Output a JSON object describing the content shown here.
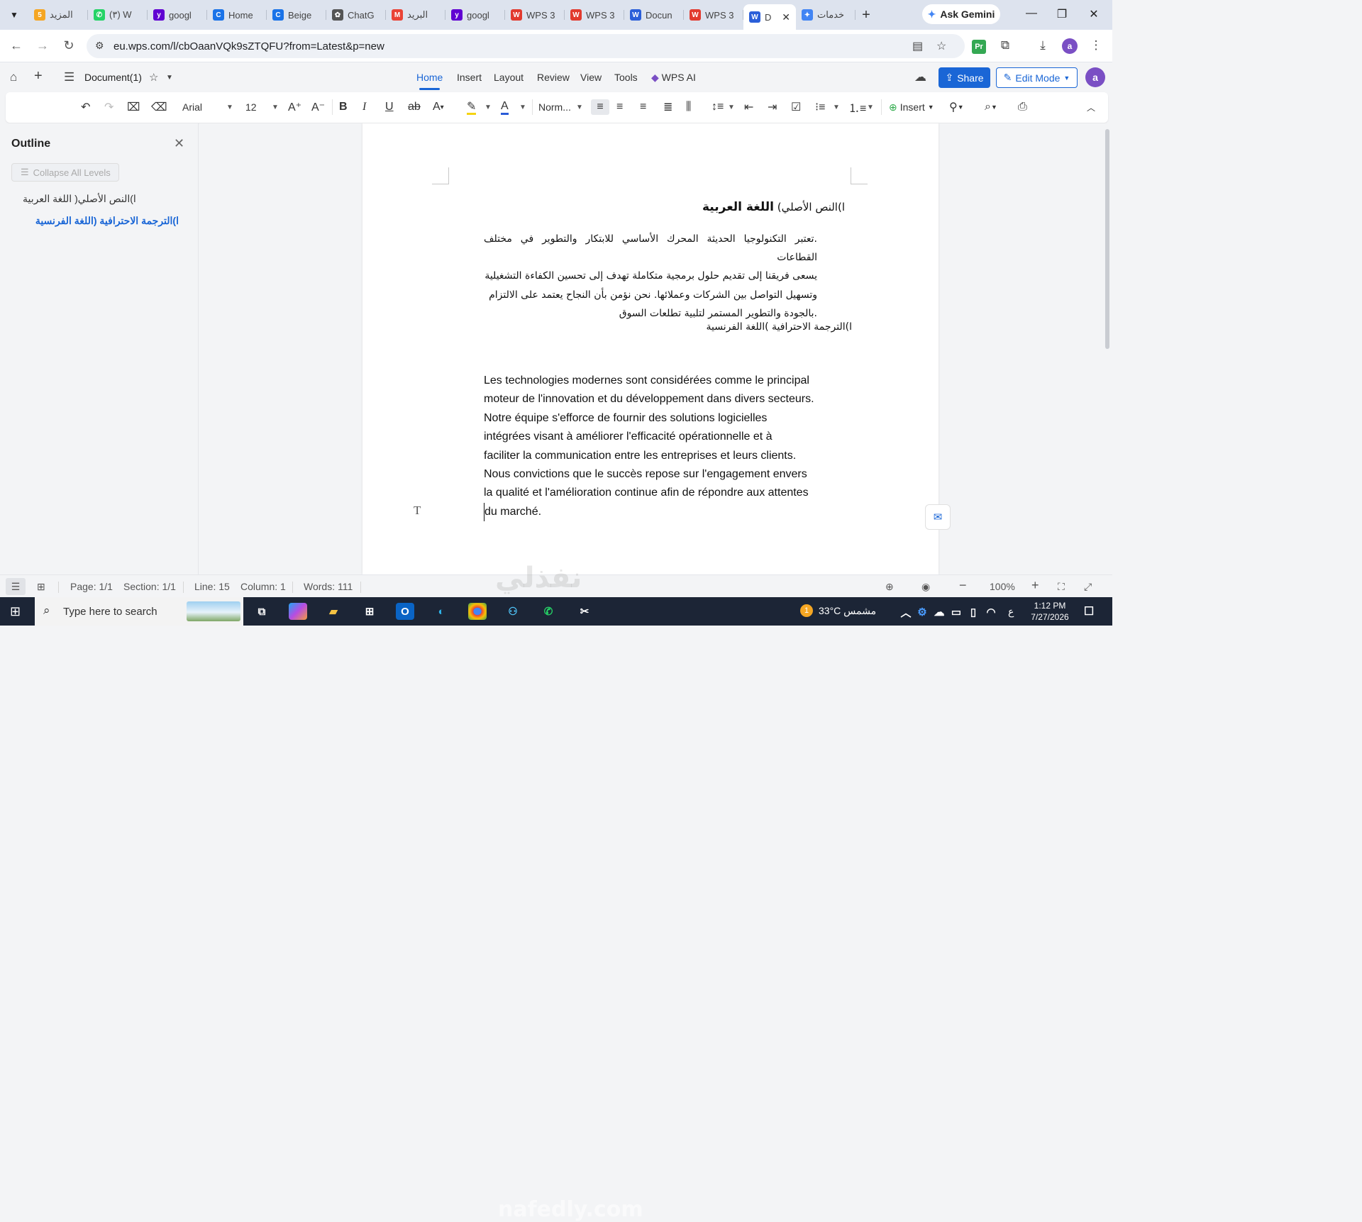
{
  "browser": {
    "tabs": [
      {
        "label": "المزيد",
        "icon": "orange-5-icon",
        "color": "#f5a623",
        "glyph": "5"
      },
      {
        "label": "(٣) W",
        "icon": "whatsapp-icon",
        "color": "#25d366",
        "glyph": "✆"
      },
      {
        "label": "googl",
        "icon": "yahoo-icon",
        "color": "#6001d2",
        "glyph": "y"
      },
      {
        "label": "Home",
        "icon": "copilot-icon",
        "color": "#1a73e8",
        "glyph": "C"
      },
      {
        "label": "Beige",
        "icon": "copilot-icon",
        "color": "#1a73e8",
        "glyph": "C"
      },
      {
        "label": "ChatG",
        "icon": "chatgpt-icon",
        "color": "#555555",
        "glyph": "✿"
      },
      {
        "label": "البريد",
        "icon": "gmail-icon",
        "color": "#ea4335",
        "glyph": "M"
      },
      {
        "label": "googl",
        "icon": "yahoo-icon",
        "color": "#6001d2",
        "glyph": "y"
      },
      {
        "label": "WPS 3",
        "icon": "wps-icon",
        "color": "#e23a2e",
        "glyph": "W"
      },
      {
        "label": "WPS 3",
        "icon": "wps-icon",
        "color": "#e23a2e",
        "glyph": "W"
      },
      {
        "label": "Docun",
        "icon": "word-icon",
        "color": "#2b5fd9",
        "glyph": "W"
      },
      {
        "label": "WPS 3",
        "icon": "wps-icon",
        "color": "#e23a2e",
        "glyph": "W"
      },
      {
        "label": "D",
        "icon": "word-icon",
        "color": "#2b5fd9",
        "glyph": "W",
        "active": true
      },
      {
        "label": "خدمات",
        "icon": "gemini-icon",
        "color": "#4285f4",
        "glyph": "✦"
      }
    ],
    "ask_gemini": "Ask Gemini",
    "url": "eu.wps.com/l/cbOaanVQk9sZTQFU?from=Latest&p=new",
    "profile_initial": "a",
    "pr_badge": "Pr"
  },
  "wps": {
    "doc_title": "Document(1)",
    "menu": [
      "Home",
      "Insert",
      "Layout",
      "Review",
      "View",
      "Tools",
      "WPS AI"
    ],
    "share": "Share",
    "edit_mode": "Edit Mode",
    "user_initial": "a",
    "font_name": "Arial",
    "font_size": "12",
    "style": "Norm...",
    "insert": "Insert",
    "accent": "#1a66d6"
  },
  "outline": {
    "title": "Outline",
    "collapse": "Collapse All Levels",
    "items": [
      "ا)النص الأصلي( اللغة العربية",
      "ا)الترجمة الاحترافية (اللغة الفرنسية"
    ]
  },
  "doc": {
    "heading1_prefix": "ا)النص الأصلي)",
    "heading1_bold": "اللغة العربية",
    "arabic_lines": [
      ".تعتبر التكنولوجيا الحديثة المحرك الأساسي للابتكار والتطوير في مختلف القطاعات",
      "يسعى فريقنا إلى تقديم حلول برمجية متكاملة تهدف إلى تحسين الكفاءة التشغيلية",
      "وتسهيل التواصل بين الشركات وعملائها. نحن نؤمن بأن النجاح يعتمد على الالتزام",
      ".بالجودة والتطوير المستمر لتلبية تطلعات السوق"
    ],
    "heading2": "ا)الترجمة الاحترافية )اللغة الفرنسية",
    "french_lines": [
      "Les technologies modernes sont considérées comme le principal",
      "moteur de l'innovation et du développement dans divers secteurs.",
      "Notre équipe s'efforce de fournir des solutions logicielles",
      "intégrées visant à améliorer l'efficacité opérationnelle et à",
      "faciliter la communication entre les entreprises et leurs clients.",
      "Nous convictions que le succès repose sur l'engagement envers",
      "la qualité et l'amélioration continue afin de répondre aux attentes",
      "du marché."
    ]
  },
  "status": {
    "page": "Page: 1/1",
    "section": "Section: 1/1",
    "line": "Line: 15",
    "column": "Column: 1",
    "words": "Words: 111",
    "zoom": "100%"
  },
  "taskbar": {
    "search_placeholder": "Type here to search",
    "weather": "33°C مشمس",
    "lang": "ع",
    "time": "1:12 PM",
    "date": "7/27/2026"
  },
  "watermark": {
    "arabic": "نفذلي",
    "url": "nafedly.com"
  }
}
